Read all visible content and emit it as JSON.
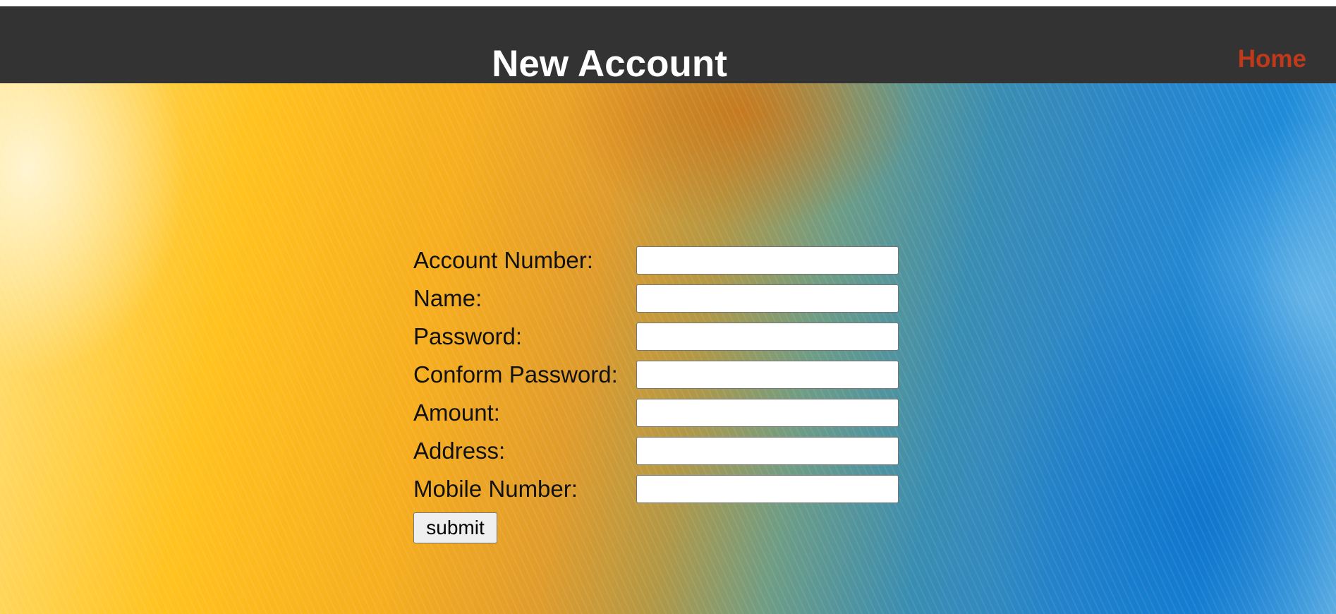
{
  "header": {
    "title": "New Account",
    "home_label": "Home",
    "background_color": "#333333",
    "title_color": "#ffffff",
    "link_color": "#c0391b"
  },
  "form": {
    "fields": [
      {
        "label": "Account Number:",
        "value": "",
        "placeholder": ""
      },
      {
        "label": "Name:",
        "value": "",
        "placeholder": ""
      },
      {
        "label": "Password:",
        "value": "",
        "placeholder": ""
      },
      {
        "label": "Conform Password:",
        "value": "",
        "placeholder": ""
      },
      {
        "label": "Amount:",
        "value": "",
        "placeholder": ""
      },
      {
        "label": "Address:",
        "value": "",
        "placeholder": ""
      },
      {
        "label": "Mobile Number:",
        "value": "",
        "placeholder": ""
      }
    ],
    "submit_label": "submit"
  },
  "background": {
    "description_colors": [
      "#ffc21e",
      "#e09c2c",
      "#6f9d85",
      "#1e8ad8"
    ]
  }
}
